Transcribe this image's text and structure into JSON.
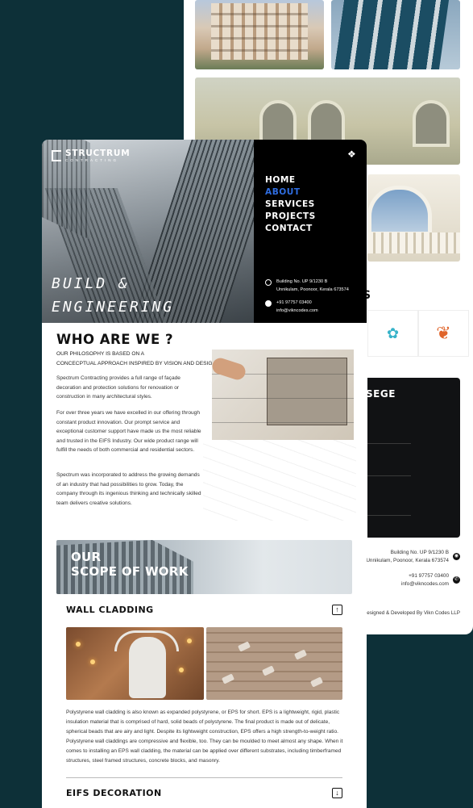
{
  "back": {
    "clients_title_fragment": "S",
    "message_title_fragment": "SEGE",
    "address_1": "Building No. UP 9/1230 B",
    "address_2": "Unnikulam, Poonoor, Kerala 673574",
    "phone": "+91 97757 03400",
    "email": "info@vikncodes.com",
    "credit": "Designed & Developed By Vikn Codes LLP"
  },
  "front": {
    "logo": {
      "name": "STRUCTRUM",
      "sub": "CONTRACTING"
    },
    "menu_toggle_icon": "diamond-grid-icon",
    "nav": [
      {
        "label": "HOME",
        "active": false
      },
      {
        "label": "ABOUT",
        "active": true
      },
      {
        "label": "SERVICES",
        "active": false
      },
      {
        "label": "PROJECTS",
        "active": false
      },
      {
        "label": "CONTACT",
        "active": false
      }
    ],
    "hero_tagline_1": "BUILD &",
    "hero_tagline_2": "ENGINEERING",
    "contact": {
      "address_1": "Building No. UP 9/1230 B",
      "address_2": "Unnikulam, Poonoor, Kerala 673574",
      "phone": "+91 97757 03400",
      "email": "info@vikncodes.com"
    },
    "who": {
      "title": "WHO ARE WE ?",
      "subtitle_1": "OUR PHILOSOPHY IS BASED ON A",
      "subtitle_2": "CONCECPTUAL APPROACH INSPIRED BY VISION AND DESIGN",
      "p1": "Spectrum Contracting provides a full range of façade decoration and protection solutions for renovation or construction in many architectural styles.",
      "p2": "For over three years we have excelled in our offering through constant product innovation. Our prompt service and exceptional customer support have made us the most reliable and trusted in the EIFS Industry. Our wide product range will fulfill the needs of both commercial and residential sectors.",
      "p3": "Spectrum was incorporated to address the growing demands of an industry that had possibilities to grow. Today, the company through its ingenious thinking and technically skilled team delivers creative solutions."
    },
    "scope": {
      "line1": "OUR",
      "line2": "SCOPE OF WORK"
    },
    "accordion": [
      {
        "title": "WALL CLADDING",
        "toggle": "↑",
        "text": "Polystyrene wall cladding is also known as expanded polystyrene, or EPS for short. EPS is a lightweight, rigid, plastic insulation material that is comprised of hard, solid beads of polystyrene. The final product is made out of delicate, spherical beads that are airy and light. Despite its lightweight construction, EPS offers a high strength-to-weight ratio. Polystyrene wall claddings are compressive and flexible, too. They can be moulded to meet almost any shape. When it comes to installing an EPS wall cladding, the material can be applied over different substrates, including timberframed structures, steel framed structures, concrete blocks, and masonry."
      },
      {
        "title": "EIFS DECORATION",
        "toggle": "↓"
      }
    ]
  }
}
